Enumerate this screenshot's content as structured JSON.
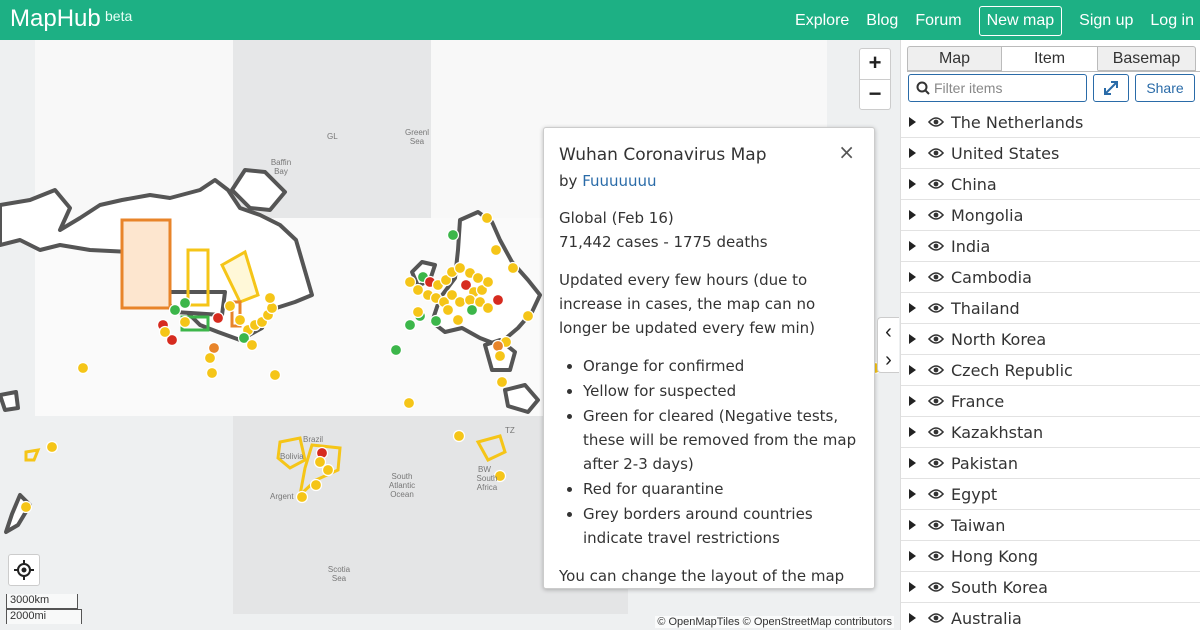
{
  "header": {
    "brand": "MapHub",
    "beta": "beta",
    "nav": [
      "Explore",
      "Blog",
      "Forum",
      "New map",
      "Sign up",
      "Log in"
    ]
  },
  "map": {
    "zoom_in": "+",
    "zoom_out": "−",
    "scale_km": "3000km",
    "scale_mi": "2000mi",
    "attribution": "© OpenMapTiles © OpenStreetMap contributors",
    "labels": {
      "gl": "GL",
      "greenland_sea": "Greenl Sea",
      "baffin_bay": "Baffin Bay",
      "south_atlantic": "South Atlantic Ocean",
      "scotia_sea": "Scotia Sea",
      "brazil": "Brazil",
      "bolivia": "Bolivia",
      "argentina": "Argent",
      "tz": "TZ",
      "bw": "BW",
      "south_africa": "South Africa"
    },
    "colors": {
      "confirmed": "#e8842a",
      "suspected": "#f5c518",
      "cleared": "#3cb64a",
      "quarantine": "#d62b1f",
      "border": "#555555"
    }
  },
  "popup": {
    "title": "Wuhan Coronavirus Map",
    "by_prefix": "by",
    "author": "Fuuuuuuu",
    "close": "×",
    "global_line": "Global (Feb 16)",
    "stats_line": "71,442 cases - 1775 deaths",
    "updated_text": "Updated every few hours (due to increase in cases, the map can no longer be updated every few min)",
    "legend": [
      "Orange for confirmed",
      "Yellow for suspected",
      "Green for cleared (Negative tests, these will be removed from the map after 2-3 days)",
      "Red for quarantine",
      "Grey borders around countries indicate travel restrictions"
    ],
    "footer_text": "You can change the layout of the map to"
  },
  "sidebar": {
    "tabs": [
      "Map",
      "Item",
      "Basemap"
    ],
    "active_tab": "Item",
    "filter_placeholder": "Filter items",
    "share_label": "Share",
    "items": [
      "The Netherlands",
      "United States",
      "China",
      "Mongolia",
      "India",
      "Cambodia",
      "Thailand",
      "North Korea",
      "Czech Republic",
      "France",
      "Kazakhstan",
      "Pakistan",
      "Egypt",
      "Taiwan",
      "Hong Kong",
      "South Korea",
      "Australia"
    ]
  }
}
